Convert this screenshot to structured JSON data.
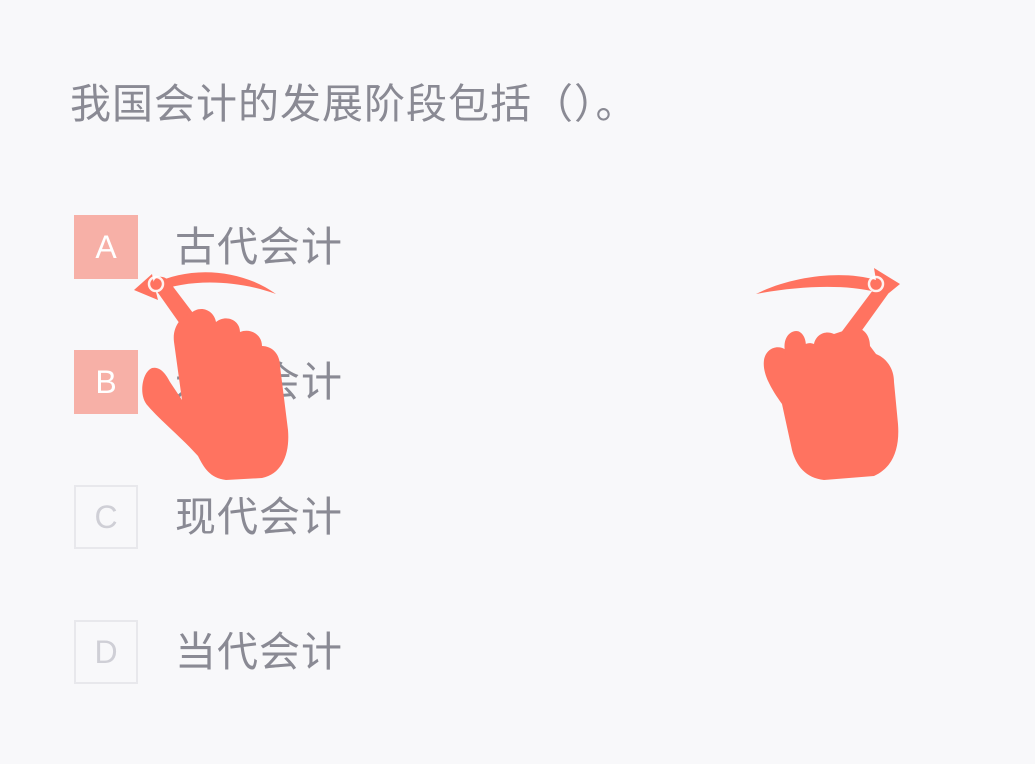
{
  "question": {
    "text": "我国会计的发展阶段包括（）。"
  },
  "options": [
    {
      "letter": "A",
      "text": "古代会计",
      "selected": true
    },
    {
      "letter": "B",
      "text": "近代会计",
      "selected": true
    },
    {
      "letter": "C",
      "text": "现代会计",
      "selected": false
    },
    {
      "letter": "D",
      "text": "当代会计",
      "selected": false
    }
  ],
  "overlays": [
    {
      "icon": "swipe-left-hand-icon",
      "direction": "left"
    },
    {
      "icon": "swipe-right-hand-icon",
      "direction": "right"
    }
  ],
  "colors": {
    "background": "#f8f8fa",
    "text": "#8a8a94",
    "selected_badge": "#f7b0a7",
    "unselected_border": "#e8e8ec",
    "unselected_letter": "#cfcfd6",
    "gesture": "#ff7360"
  }
}
